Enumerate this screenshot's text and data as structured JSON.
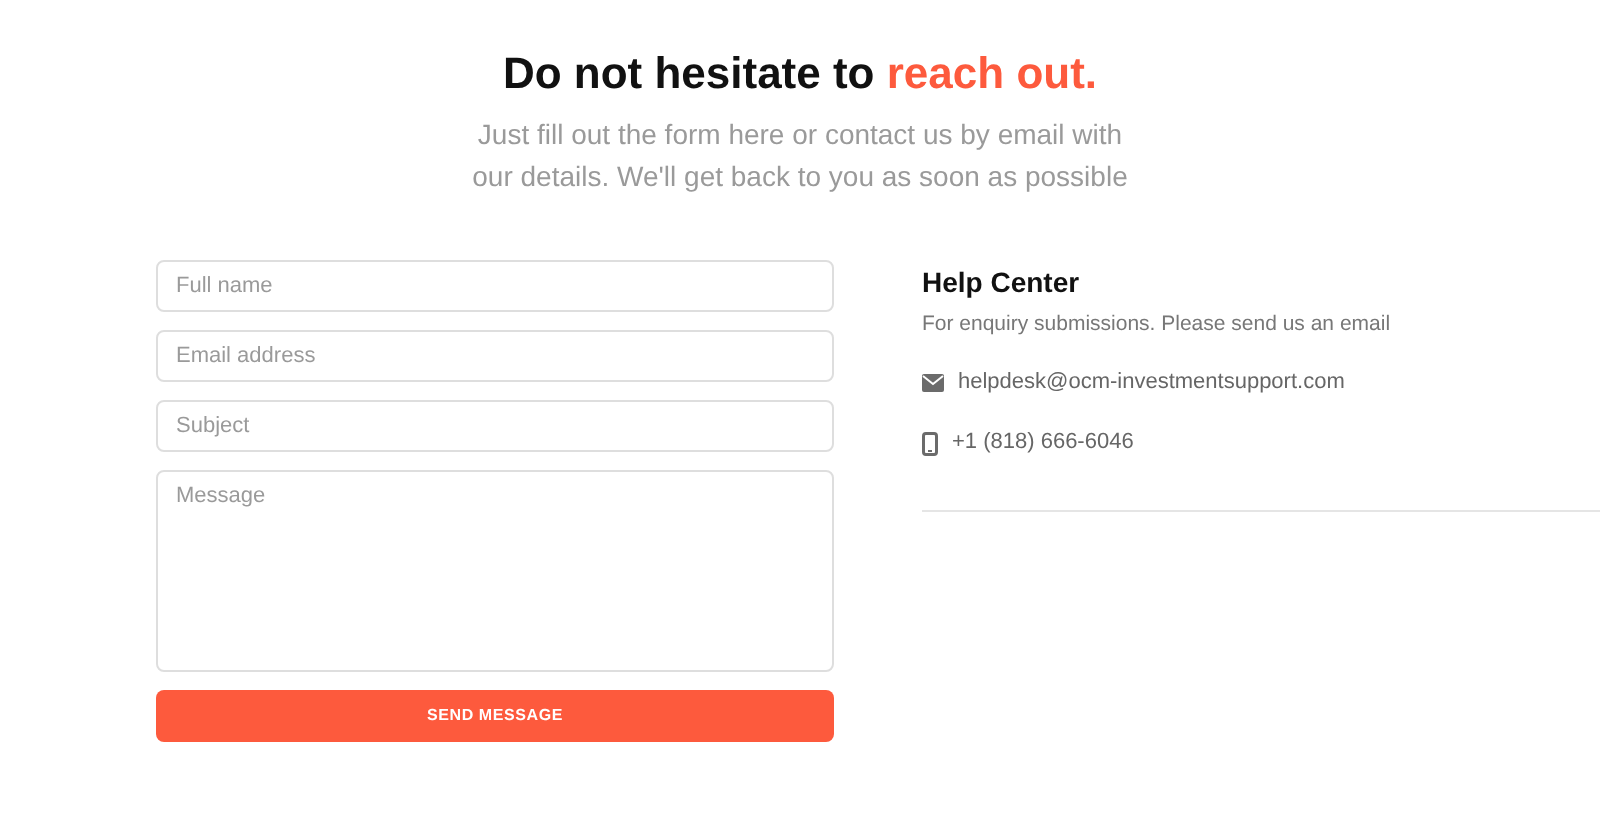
{
  "heading": {
    "text": "Do not hesitate to",
    "accent": "reach out."
  },
  "subtitle": [
    "Just fill out the form here or contact us by email with",
    "our details. We'll get back to you as soon as possible"
  ],
  "form": {
    "fields": [
      {
        "kind": "input",
        "placeholder": "Full name"
      },
      {
        "kind": "input",
        "placeholder": "Email address"
      },
      {
        "kind": "input",
        "placeholder": "Subject"
      },
      {
        "kind": "textarea",
        "placeholder": "Message"
      }
    ],
    "button": "SEND MESSAGE"
  },
  "help": {
    "title": "Help Center",
    "description": "For enquiry submissions. Please send us an email",
    "contacts": [
      {
        "kind": "email",
        "text": "helpdesk@ocm-investmentsupport.com"
      },
      {
        "kind": "phone",
        "text": "+1 (818) 666-6046"
      }
    ]
  }
}
